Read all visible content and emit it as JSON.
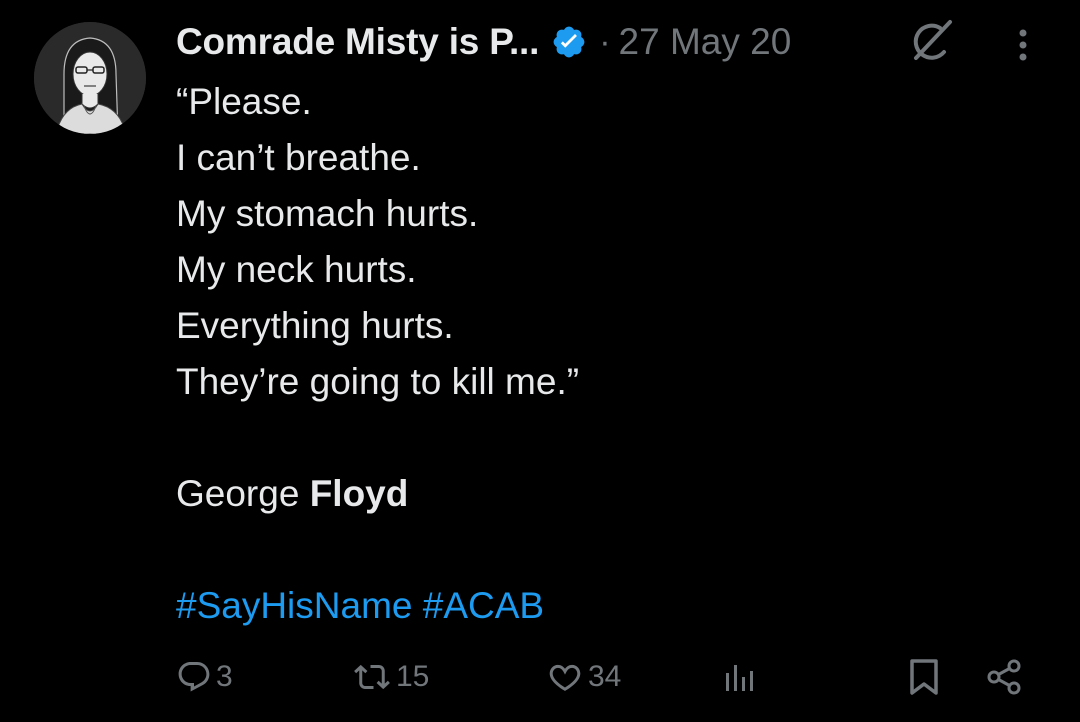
{
  "author": {
    "display_name": "Comrade Misty is P...",
    "verified": true,
    "date_separator": "·",
    "date": "27 May 20"
  },
  "tweet": {
    "lines": [
      "“Please.",
      "I can’t breathe.",
      "My stomach hurts.",
      "My neck hurts.",
      "Everything hurts.",
      "They’re going to kill me.”"
    ],
    "name_regular": "George",
    "name_bold": "Floyd",
    "hashtags": [
      "#SayHisName",
      "#ACAB"
    ]
  },
  "actions": {
    "replies": "3",
    "retweets": "15",
    "likes": "34"
  },
  "icons": {
    "verified": "verified-badge-icon",
    "grok": "grok-icon",
    "more": "more-options-icon",
    "reply": "reply-icon",
    "retweet": "retweet-icon",
    "like": "heart-icon",
    "views": "views-icon",
    "bookmark": "bookmark-icon",
    "share": "share-icon"
  },
  "colors": {
    "background": "#000000",
    "text": "#e7e9ea",
    "muted": "#71767b",
    "link": "#1d9bf0"
  }
}
